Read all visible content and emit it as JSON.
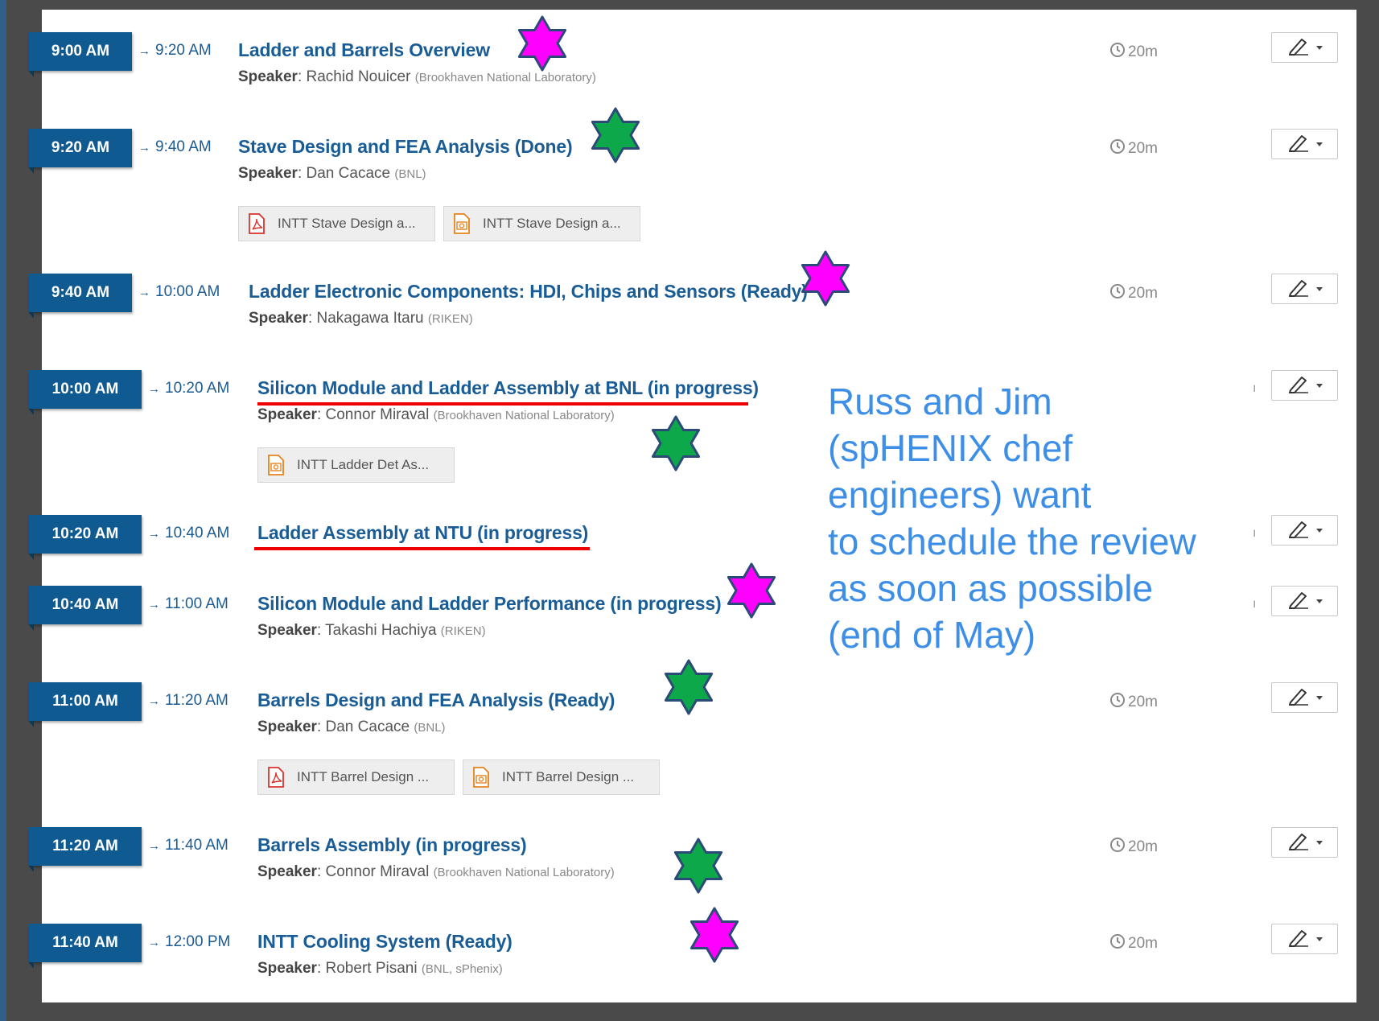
{
  "entries": [
    {
      "start": "9:00 AM",
      "end": "9:20 AM",
      "title": "Ladder and Barrels Overview",
      "speaker_label": "Speaker",
      "speaker": "Rachid Nouicer",
      "affiliation": "(Brookhaven National Laboratory)",
      "duration": "20m",
      "attachments": [],
      "star": "magenta"
    },
    {
      "start": "9:20 AM",
      "end": "9:40 AM",
      "title": "Stave Design and FEA Analysis (Done)",
      "speaker_label": "Speaker",
      "speaker": "Dan Cacace",
      "affiliation": "(BNL)",
      "duration": "20m",
      "attachments": [
        {
          "type": "pdf",
          "label": "INTT Stave Design a..."
        },
        {
          "type": "slides",
          "label": "INTT Stave Design a..."
        }
      ],
      "star": "green"
    },
    {
      "start": "9:40 AM",
      "end": "10:00 AM",
      "title": "Ladder Electronic Components: HDI, Chips and Sensors (Ready)",
      "speaker_label": "Speaker",
      "speaker": "Nakagawa Itaru",
      "affiliation": "(RIKEN)",
      "duration": "20m",
      "attachments": [],
      "star": "magenta"
    },
    {
      "start": "10:00 AM",
      "end": "10:20 AM",
      "title": "Silicon Module and Ladder Assembly at BNL (in progress)",
      "speaker_label": "Speaker",
      "speaker": "Connor Miraval",
      "affiliation": "(Brookhaven National Laboratory)",
      "duration": "ı",
      "attachments": [
        {
          "type": "slides",
          "label": "INTT Ladder Det As..."
        }
      ],
      "star": "green"
    },
    {
      "start": "10:20 AM",
      "end": "10:40 AM",
      "title": "Ladder Assembly at NTU (in progress)",
      "speaker_label": "",
      "speaker": "",
      "affiliation": "",
      "duration": "ı",
      "attachments": [],
      "star": ""
    },
    {
      "start": "10:40 AM",
      "end": "11:00 AM",
      "title": "Silicon Module and Ladder Performance (in progress)",
      "speaker_label": "Speaker",
      "speaker": "Takashi Hachiya",
      "affiliation": "(RIKEN)",
      "duration": "ı",
      "attachments": [],
      "star": "magenta"
    },
    {
      "start": "11:00 AM",
      "end": "11:20 AM",
      "title": "Barrels Design and FEA Analysis (Ready)",
      "speaker_label": "Speaker",
      "speaker": "Dan Cacace",
      "affiliation": "(BNL)",
      "duration": "20m",
      "attachments": [
        {
          "type": "pdf",
          "label": "INTT Barrel Design ..."
        },
        {
          "type": "slides",
          "label": "INTT Barrel Design ..."
        }
      ],
      "star": "green"
    },
    {
      "start": "11:20 AM",
      "end": "11:40 AM",
      "title": "Barrels Assembly (in progress)",
      "speaker_label": "Speaker",
      "speaker": "Connor Miraval",
      "affiliation": "(Brookhaven National Laboratory)",
      "duration": "20m",
      "attachments": [],
      "star": "green"
    },
    {
      "start": "11:40 AM",
      "end": "12:00 PM",
      "title": "INTT Cooling System (Ready)",
      "speaker_label": "Speaker",
      "speaker": "Robert Pisani",
      "affiliation": "(BNL, sPhenix)",
      "duration": "20m",
      "attachments": [],
      "star": "magenta"
    }
  ],
  "annotation": {
    "lines": [
      "Russ and Jim",
      "(spHENIX chef",
      "engineers) want",
      "to schedule the review",
      "as soon as possible",
      "(end of May)"
    ]
  },
  "colors": {
    "badge": "#0f5a91",
    "title": "#1a5c96",
    "star_magenta": "#ff00ff",
    "star_green": "#0ca84a",
    "star_outline": "#2b4a78",
    "underline": "#ee0000",
    "note": "#3d8ee6"
  }
}
